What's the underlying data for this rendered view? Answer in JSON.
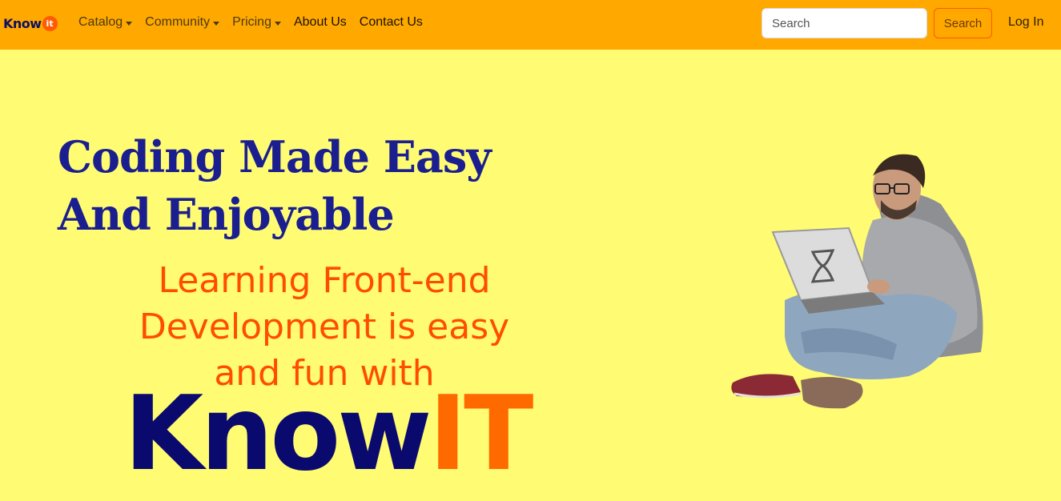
{
  "navbar": {
    "brand_text": "Know",
    "brand_badge": "it",
    "links": [
      {
        "label": "Catalog",
        "dropdown": true
      },
      {
        "label": "Community",
        "dropdown": true
      },
      {
        "label": "Pricing",
        "dropdown": true
      },
      {
        "label": "About Us",
        "dropdown": false
      },
      {
        "label": "Contact Us",
        "dropdown": false
      }
    ],
    "search_placeholder": "Search",
    "search_button": "Search",
    "login": "Log In"
  },
  "hero": {
    "title_line1": "Coding Made Easy",
    "title_line2": "And Enjoyable",
    "sub_line1": "Learning Front-end",
    "sub_line2": "Development is easy",
    "sub_line3": "and fun with",
    "logo_know": "Know",
    "logo_it": "IT"
  },
  "colors": {
    "navbar_bg": "#ffa800",
    "page_bg": "#fffb73",
    "title": "#1a1e8f",
    "subtitle": "#ff4d00",
    "logo_know": "#0a0a6e",
    "logo_it": "#ff6a00"
  },
  "icons": {
    "illustration": "man-with-laptop-illustration"
  }
}
